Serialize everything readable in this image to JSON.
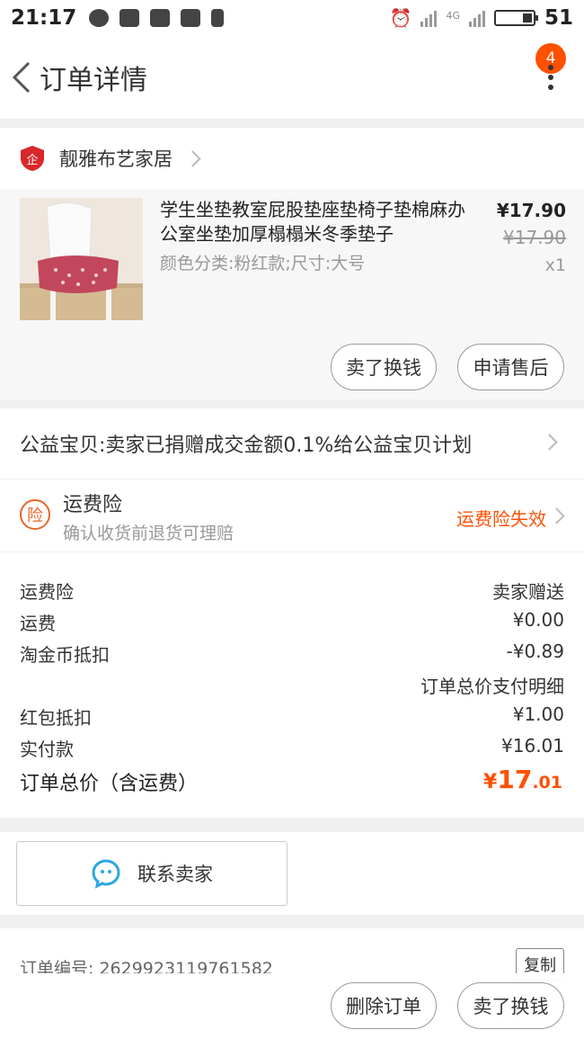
{
  "status_bar": {
    "time": "21:17",
    "network": "4G",
    "battery": "51"
  },
  "header": {
    "title": "订单详情",
    "badge": "4"
  },
  "shop": {
    "name": "靓雅布艺家居"
  },
  "product": {
    "title": "学生坐垫教室屁股垫座垫椅子垫棉麻办公室坐垫加厚榻榻米冬季垫子",
    "spec": "颜色分类:粉红款;尺寸:大号",
    "price": "¥17.90",
    "original_price": "¥17.90",
    "quantity": "x1",
    "buttons": [
      "卖了换钱",
      "申请售后"
    ]
  },
  "charity": {
    "text": "公益宝贝:卖家已捐赠成交金额0.1%给公益宝贝计划"
  },
  "insurance": {
    "icon_text": "险",
    "title": "运费险",
    "subtitle": "确认收货前退货可理赔",
    "status": "运费险失效"
  },
  "fees": {
    "rows": [
      {
        "label": "运费险",
        "value": "卖家赠送"
      },
      {
        "label": "运费",
        "value": "¥0.00"
      },
      {
        "label": "淘金币抵扣",
        "value": "-¥0.89"
      },
      {
        "label": "红包抵扣",
        "value": "¥1.00"
      },
      {
        "label": "实付款",
        "value": "¥16.01"
      }
    ],
    "detail_link": "订单总价支付明细",
    "total_label": "订单总价（含运费）",
    "total_currency": "¥",
    "total_integer": "17",
    "total_decimal": ".01"
  },
  "contact": {
    "label": "联系卖家"
  },
  "order": {
    "number_label": "订单编号:",
    "number": "2629923119761582",
    "copy_label": "复制"
  },
  "bottom": {
    "delete_label": "删除订单",
    "sell_label": "卖了换钱"
  },
  "colors": {
    "accent": "#ff5000",
    "insurance": "#e8662a",
    "chat": "#29a7e1",
    "shop": "#d8282a"
  }
}
